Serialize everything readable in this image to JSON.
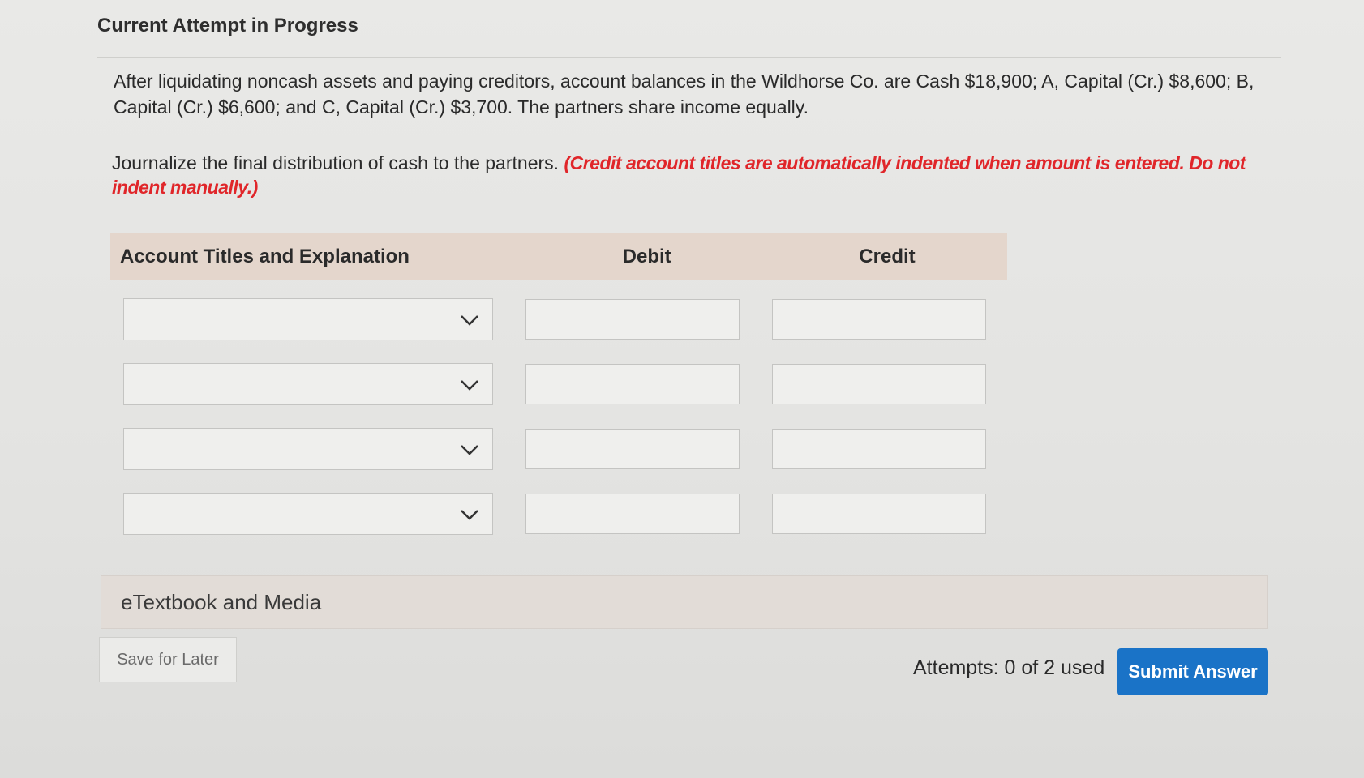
{
  "header": {
    "title": "Current Attempt in Progress"
  },
  "problem": {
    "text": "After liquidating noncash assets and paying creditors, account balances in the Wildhorse Co. are Cash $18,900; A, Capital (Cr.) $8,600; B, Capital (Cr.) $6,600; and C, Capital (Cr.) $3,700. The partners share income equally."
  },
  "instructions": {
    "text": "Journalize the final distribution of cash to the partners. ",
    "note": "(Credit account titles are automatically indented when amount is entered. Do not indent manually.)"
  },
  "journal": {
    "columns": {
      "account": "Account Titles and Explanation",
      "debit": "Debit",
      "credit": "Credit"
    },
    "rows": [
      {
        "account": "",
        "debit": "",
        "credit": ""
      },
      {
        "account": "",
        "debit": "",
        "credit": ""
      },
      {
        "account": "",
        "debit": "",
        "credit": ""
      },
      {
        "account": "",
        "debit": "",
        "credit": ""
      }
    ]
  },
  "resources": {
    "etextbook_label": "eTextbook and Media"
  },
  "footer": {
    "save_label": "Save for Later",
    "attempts_label": "Attempts: 0 of 2 used",
    "submit_label": "Submit Answer"
  },
  "colors": {
    "submit_button": "#1a73c7",
    "note_text": "#e0262a",
    "table_header": "#e4d6cc"
  }
}
